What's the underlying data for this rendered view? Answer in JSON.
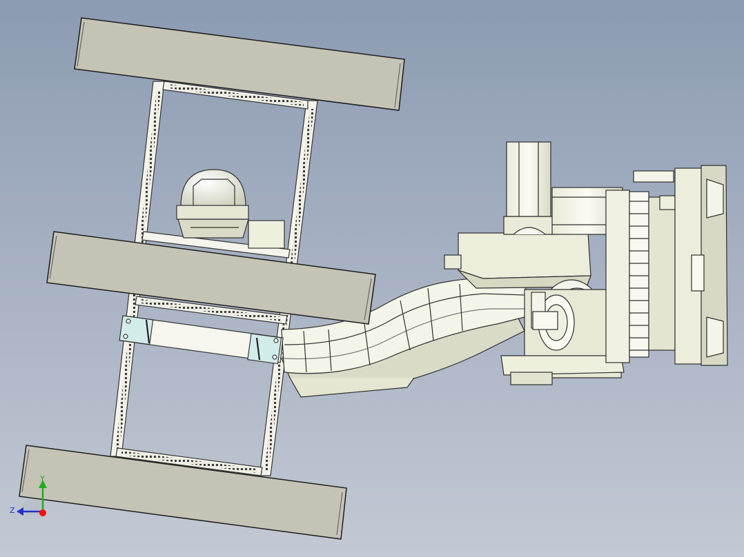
{
  "viewport": {
    "background_top": "#8c9bb2",
    "background_bottom": "#c3c9d4"
  },
  "colors": {
    "panel_fill": "#c4c3b5",
    "panel_stroke": "#1c1c1c",
    "body_fill": "#f2f3e6",
    "body_shade": "#d9dbc7",
    "bracket_fill": "#d2ecea",
    "line": "#3a3a3a"
  },
  "triad": {
    "y_label": "Y",
    "z_label": "Z",
    "y_color": "#22aa22",
    "z_color": "#2233cc",
    "x_color": "#ee1111"
  },
  "model": {
    "panels": [
      "upper-panel",
      "middle-panel",
      "lower-panel"
    ],
    "icons": [
      "cad-assembly-icon",
      "coordinate-triad-icon"
    ]
  }
}
